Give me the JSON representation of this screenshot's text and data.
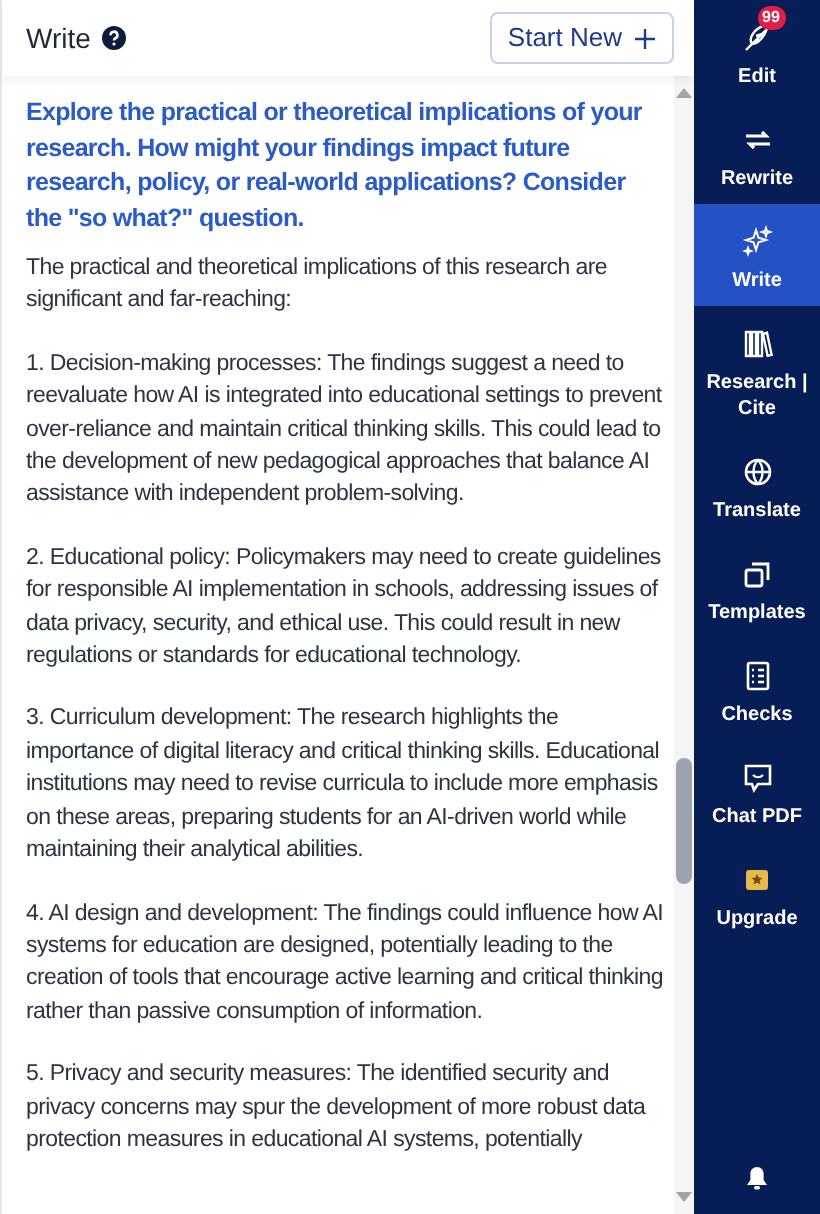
{
  "header": {
    "title": "Write",
    "start_new": "Start New"
  },
  "prompt": "Explore the practical or theoretical implications of your research. How might your findings impact future research, policy, or real-world applications? Consider the \"so what?\" question.",
  "paragraphs": [
    "The practical and theoretical implications of this research are significant and far-reaching:",
    "1. Decision-making processes: The findings suggest a need to reevaluate how AI is integrated into educational settings to prevent over-reliance and maintain critical thinking skills. This could lead to the development of new pedagogical approaches that balance AI assistance with independent problem-solving.",
    "2. Educational policy: Policymakers may need to create guidelines for responsible AI implementation in schools, addressing issues of data privacy, security, and ethical use. This could result in new regulations or standards for educational technology.",
    "3. Curriculum development: The research highlights the importance of digital literacy and critical thinking skills. Educational institutions may need to revise curricula to include more emphasis on these areas, preparing students for an AI-driven world while maintaining their analytical abilities.",
    "4. AI design and development: The findings could influence how AI systems for education are designed, potentially leading to the creation of tools that encourage active learning and critical thinking rather than passive consumption of information.",
    "5. Privacy and security measures: The identified security and privacy concerns may spur the development of more robust data protection measures in educational AI systems, potentially"
  ],
  "sidebar": {
    "items": [
      {
        "kind": "edit",
        "label": "Edit",
        "badge": "99",
        "selected": false
      },
      {
        "kind": "rewrite",
        "label": "Rewrite",
        "selected": false
      },
      {
        "kind": "write",
        "label": "Write",
        "selected": true
      },
      {
        "kind": "research",
        "label": "Research | Cite",
        "selected": false
      },
      {
        "kind": "translate",
        "label": "Translate",
        "selected": false
      },
      {
        "kind": "templates",
        "label": "Templates",
        "selected": false
      },
      {
        "kind": "checks",
        "label": "Checks",
        "selected": false
      },
      {
        "kind": "chat",
        "label": "Chat PDF",
        "selected": false
      },
      {
        "kind": "upgrade",
        "label": "Upgrade",
        "selected": false
      }
    ]
  }
}
